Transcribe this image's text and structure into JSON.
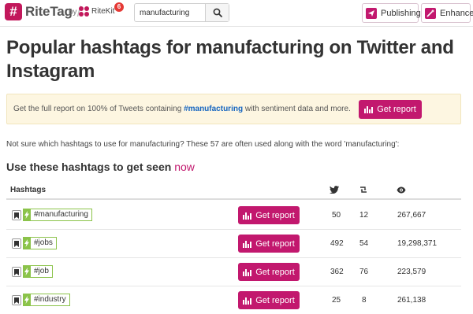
{
  "nav": {
    "logo_mark": "#",
    "logo_text": "RiteTag",
    "by_text": "by",
    "ritekit_text": "RiteKit",
    "badge_count": "6",
    "search_value": "manufacturing",
    "publishing_label": "Publishing",
    "enhance_label": "Enhance"
  },
  "page": {
    "headline": "Popular hashtags for manufacturing on Twitter and Instagram",
    "banner_before": "Get the full report on 100% of Tweets containing ",
    "banner_tag": "#manufacturing",
    "banner_after": " with sentiment data and more.",
    "banner_button": "Get report",
    "intro": "Not sure which hashtags to use for manufacturing? These 57 are often used along with the word 'manufacturing':",
    "subhead_main": "Use these hashtags to get seen ",
    "subhead_accent": "now"
  },
  "table": {
    "col_hashtags": "Hashtags",
    "col_icons": [
      "twitter-icon",
      "retweet-icon",
      "eye-icon"
    ],
    "button_label": "Get report",
    "rows": [
      {
        "tag": "#manufacturing",
        "tweets": "50",
        "retweets": "12",
        "views": "267,667"
      },
      {
        "tag": "#jobs",
        "tweets": "492",
        "retweets": "54",
        "views": "19,298,371"
      },
      {
        "tag": "#job",
        "tweets": "362",
        "retweets": "76",
        "views": "223,579"
      },
      {
        "tag": "#industry",
        "tweets": "25",
        "retweets": "8",
        "views": "261,138"
      }
    ]
  },
  "colors": {
    "accent": "#c2186e",
    "hashtag_green": "#8bc34a",
    "link_blue": "#1565c0",
    "banner_bg": "#fdf6e1"
  }
}
